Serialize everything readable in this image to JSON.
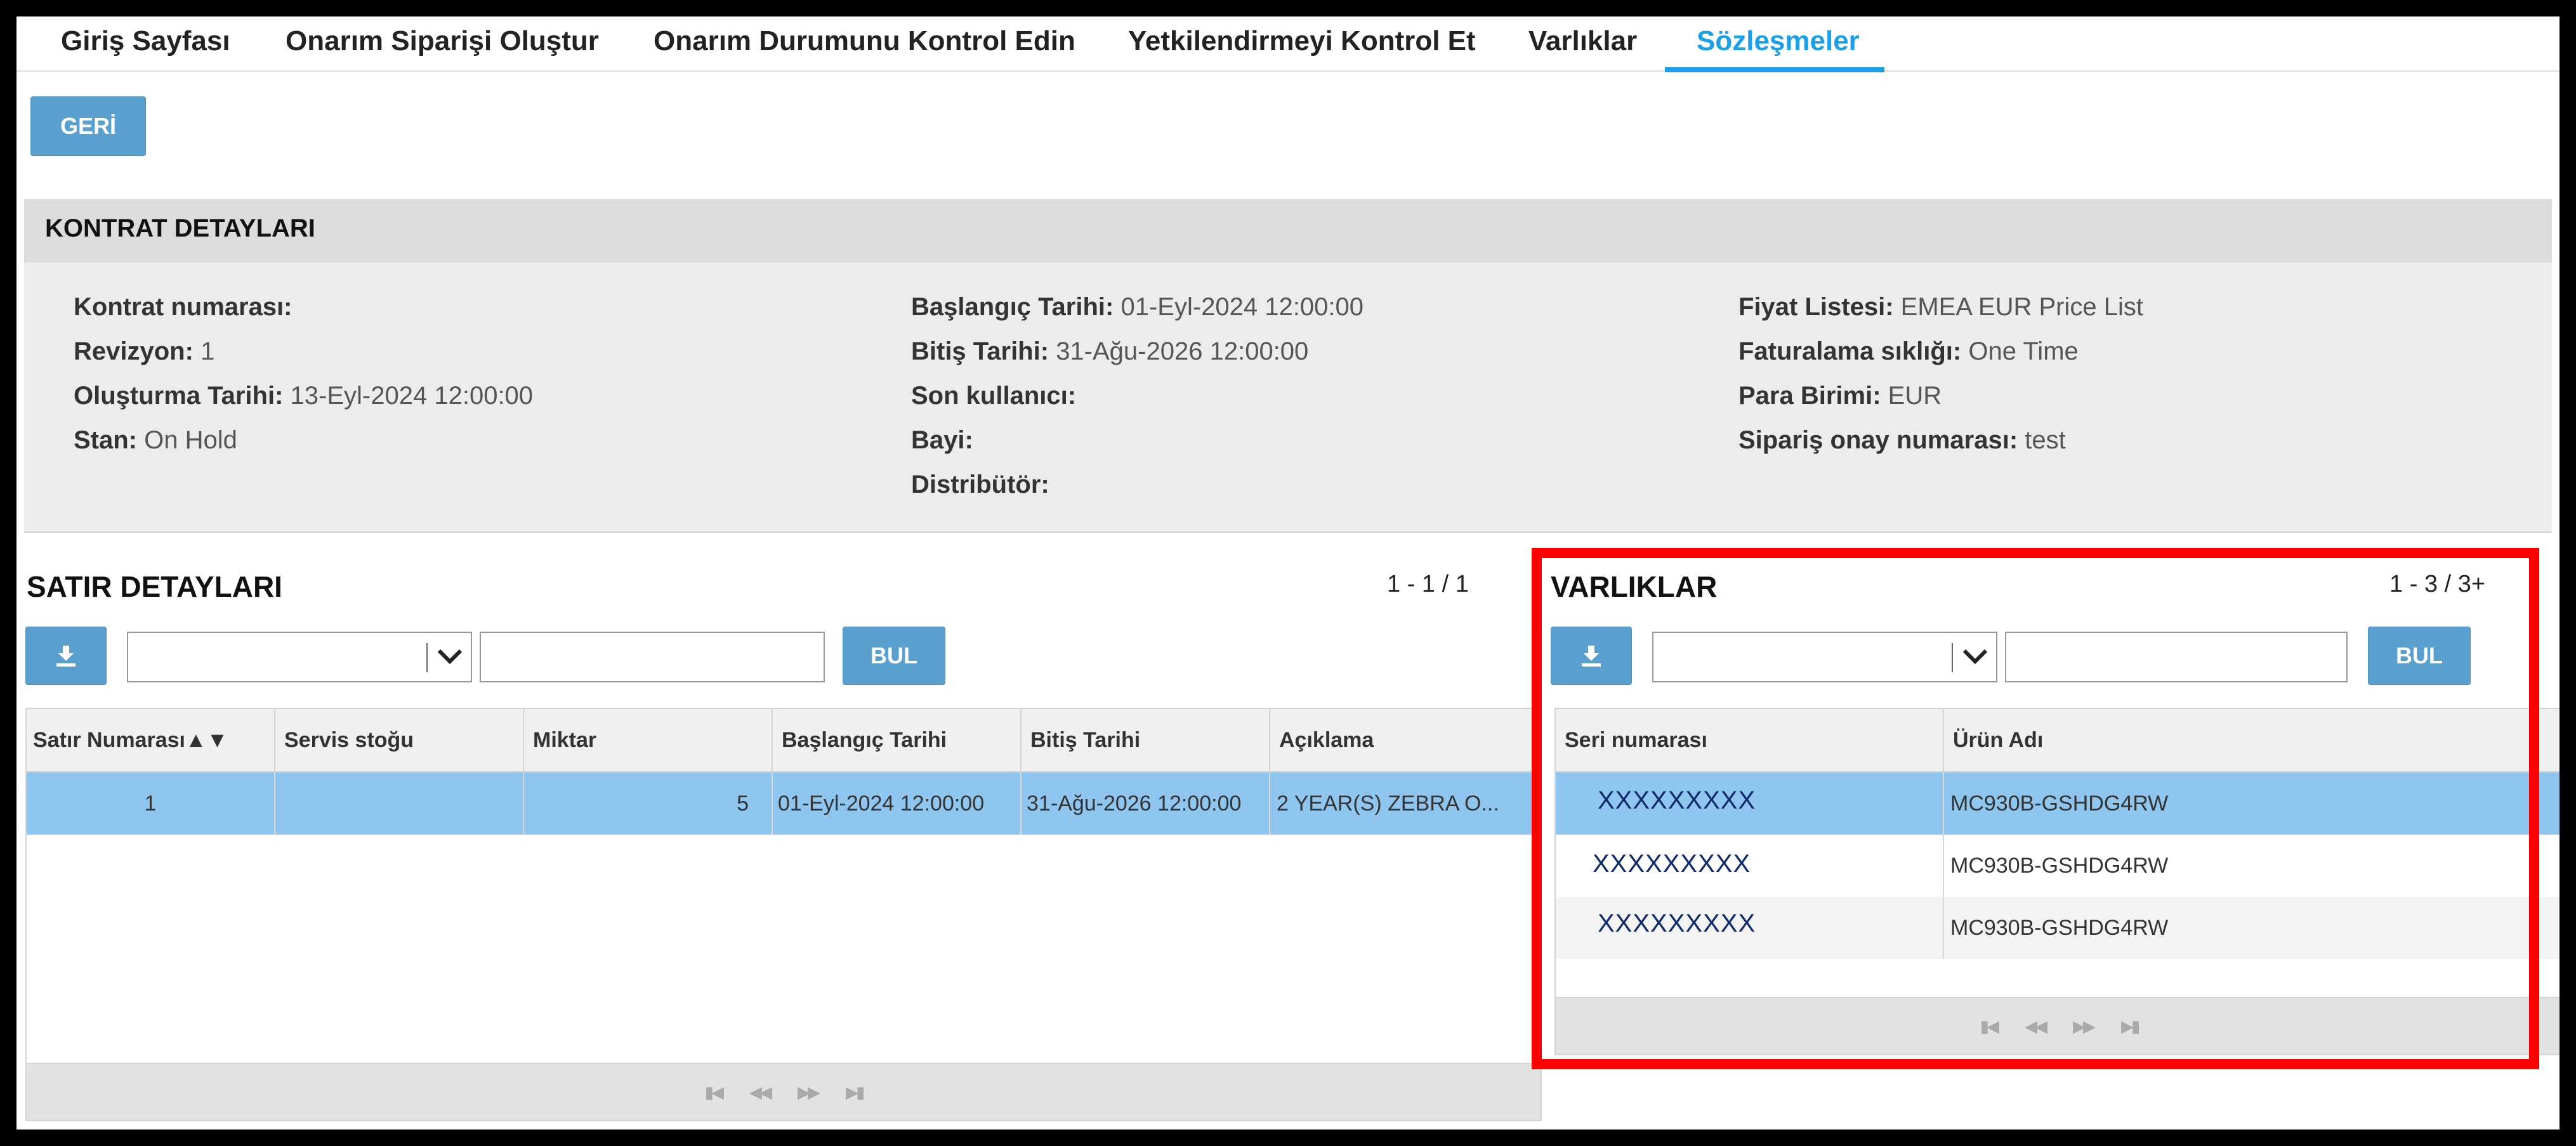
{
  "nav": {
    "tabs": [
      {
        "label": "Giriş Sayfası"
      },
      {
        "label": "Onarım Siparişi Oluştur"
      },
      {
        "label": "Onarım Durumunu Kontrol Edin"
      },
      {
        "label": "Yetkilendirmeyi Kontrol Et"
      },
      {
        "label": "Varlıklar"
      },
      {
        "label": "Sözleşmeler"
      }
    ],
    "active_tab": "Sözleşmeler"
  },
  "back_button": "GERİ",
  "contract": {
    "title": "KONTRAT DETAYLARI",
    "col1": [
      {
        "label": "Kontrat numarası:",
        "value": ""
      },
      {
        "label": "Revizyon:",
        "value": "1"
      },
      {
        "label": "Oluşturma Tarihi:",
        "value": "13-Eyl-2024 12:00:00"
      },
      {
        "label": "Stan:",
        "value": "On Hold"
      }
    ],
    "col2": [
      {
        "label": "Başlangıç Tarihi:",
        "value": "01-Eyl-2024 12:00:00"
      },
      {
        "label": "Bitiş Tarihi:",
        "value": "31-Ağu-2026 12:00:00"
      },
      {
        "label": "Son kullanıcı:",
        "value": ""
      },
      {
        "label": "Bayi:",
        "value": ""
      },
      {
        "label": "Distribütör:",
        "value": ""
      }
    ],
    "col3": [
      {
        "label": "Fiyat Listesi:",
        "value": "EMEA EUR Price List"
      },
      {
        "label": "Faturalama sıklığı:",
        "value": "One Time"
      },
      {
        "label": "Para Birimi:",
        "value": "EUR"
      },
      {
        "label": "Sipariş onay numarası:",
        "value": "test"
      }
    ]
  },
  "lines": {
    "title": "SATIR DETAYLARI",
    "pager": "1 - 1 / 1",
    "find_button": "BUL",
    "filter_value": "",
    "search_value": "",
    "columns": [
      "Satır Numarası",
      "Servis stoğu",
      "Miktar",
      "Başlangıç Tarihi",
      "Bitiş Tarihi",
      "Açıklama"
    ],
    "sort_indicator": "▲▼",
    "rows": [
      {
        "line": "1",
        "stock": "",
        "qty": "5",
        "start": "01-Eyl-2024 12:00:00",
        "end": "31-Ağu-2026 12:00:00",
        "desc": "2 YEAR(S) ZEBRA O..."
      }
    ]
  },
  "assets": {
    "title": "VARLIKLAR",
    "pager": "1 - 3 / 3+",
    "find_button": "BUL",
    "filter_value": "",
    "search_value": "",
    "columns": [
      "Seri numarası",
      "Ürün Adı"
    ],
    "rows": [
      {
        "serial": "XXXXXXXXX",
        "product": "MC930B-GSHDG4RW"
      },
      {
        "serial": "XXXXXXXXX",
        "product": "MC930B-GSHDG4RW"
      },
      {
        "serial": "XXXXXXXXX",
        "product": "MC930B-GSHDG4RW"
      }
    ]
  },
  "colors": {
    "accent": "#1ba0e8",
    "button": "#5aa0cf",
    "selected_row": "#8fc6f0",
    "highlight": "#ff0000"
  },
  "icons": [
    "download-icon",
    "chevron-down-icon",
    "first-page-icon",
    "prev-page-icon",
    "next-page-icon",
    "last-page-icon"
  ]
}
